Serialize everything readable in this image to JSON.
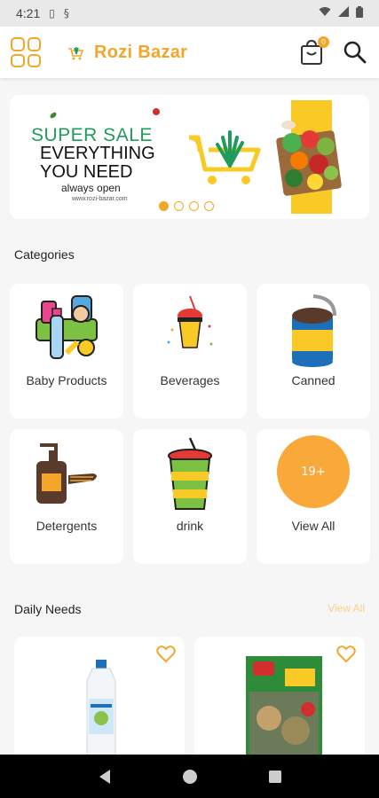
{
  "status": {
    "time": "4:21"
  },
  "header": {
    "brand": "Rozi Bazar",
    "cart_count": "0"
  },
  "banner": {
    "line1": "SUPER SALE",
    "line2": "EVERYTHING",
    "line3": "YOU NEED",
    "line4": "always open",
    "url": "www.rozi-bazar.com"
  },
  "categories": {
    "title": "Categories",
    "items": [
      {
        "label": "Baby Products"
      },
      {
        "label": "Beverages"
      },
      {
        "label": "Canned"
      },
      {
        "label": "Detergents"
      },
      {
        "label": "drink"
      },
      {
        "label": "View All",
        "count": "19+"
      }
    ]
  },
  "daily_needs": {
    "title": "Daily Needs",
    "view_all": "View All"
  },
  "colors": {
    "accent": "#f4a62a",
    "green": "#1f9c5a"
  }
}
